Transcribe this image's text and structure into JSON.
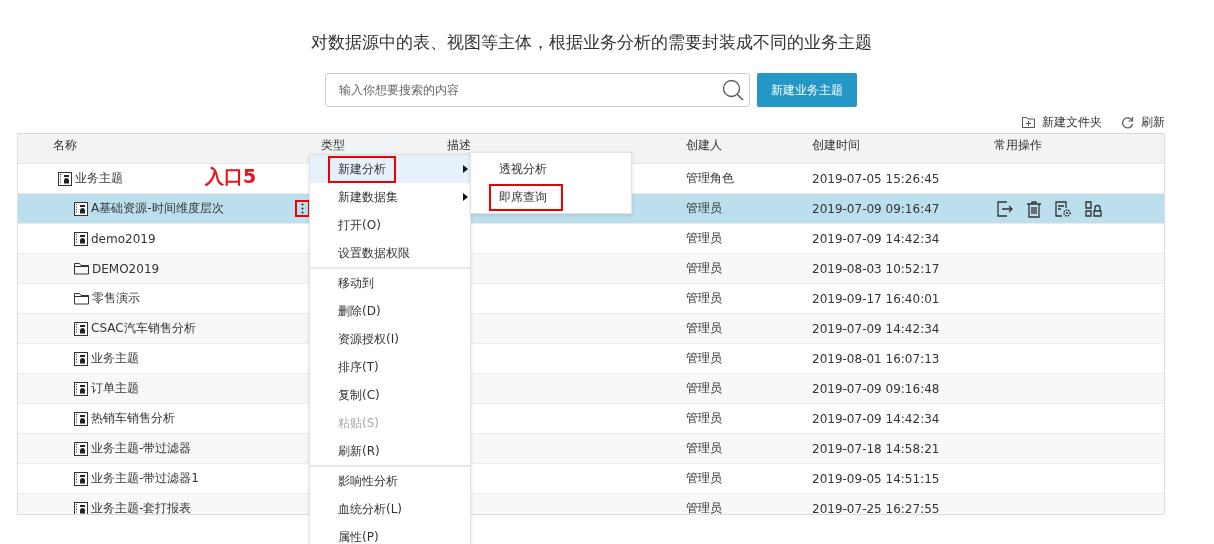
{
  "heading": "对数据源中的表、视图等主体，根据业务分析的需要封装成不同的业务主题",
  "search": {
    "placeholder": "输入你想要搜索的内容"
  },
  "create_button": "新建业务主题",
  "toolbar": [
    {
      "kind": "new-folder",
      "label": "新建文件夹"
    },
    {
      "kind": "refresh",
      "label": "刷新"
    }
  ],
  "table": {
    "columns": [
      "名称",
      "类型",
      "描述",
      "创建人",
      "创建时间",
      "常用操作"
    ],
    "rows": [
      {
        "kind": "topic",
        "name": "业务主题",
        "creator": "管理角色",
        "created": "2019-07-05 15:26:45",
        "selected": false,
        "children": [
          {
            "kind": "topic",
            "name": "A基础资源-时间维度层次",
            "creator": "管理员",
            "created": "2019-07-09 09:16:47",
            "selected": true,
            "more_button_annotated": true
          },
          {
            "kind": "topic",
            "name": "demo2019",
            "creator": "管理员",
            "created": "2019-07-09 14:42:34",
            "selected": false
          },
          {
            "kind": "folder",
            "name": "DEMO2019",
            "creator": "管理员",
            "created": "2019-08-03 10:52:17",
            "selected": false
          },
          {
            "kind": "folder",
            "name": "零售演示",
            "creator": "管理员",
            "created": "2019-09-17 16:40:01",
            "selected": false
          },
          {
            "kind": "topic",
            "name": "CSAC汽车销售分析",
            "creator": "管理员",
            "created": "2019-07-09 14:42:34",
            "selected": false
          },
          {
            "kind": "topic",
            "name": "业务主题",
            "creator": "管理员",
            "created": "2019-08-01 16:07:13",
            "selected": false
          },
          {
            "kind": "topic",
            "name": "订单主题",
            "creator": "管理员",
            "created": "2019-07-09 09:16:48",
            "selected": false
          },
          {
            "kind": "topic",
            "name": "热销车销售分析",
            "creator": "管理员",
            "created": "2019-07-09 14:42:34",
            "selected": false
          },
          {
            "kind": "topic",
            "name": "业务主题-带过滤器",
            "creator": "管理员",
            "created": "2019-07-18 14:58:21",
            "selected": false
          },
          {
            "kind": "topic",
            "name": "业务主题-带过滤器1",
            "creator": "管理员",
            "created": "2019-09-05 14:51:15",
            "selected": false
          },
          {
            "kind": "topic",
            "name": "业务主题-套打报表",
            "creator": "管理员",
            "created": "2019-07-25 16:27:55",
            "selected": false
          }
        ]
      }
    ]
  },
  "annotation": "入口5",
  "context_menu": {
    "groups": [
      [
        {
          "label": "新建分析",
          "submenu": true,
          "selected": true,
          "annotated": true,
          "disabled": false
        },
        {
          "label": "新建数据集",
          "submenu": true,
          "selected": false,
          "annotated": false,
          "disabled": false
        },
        {
          "label": "打开(O)",
          "submenu": false,
          "selected": false,
          "annotated": false,
          "disabled": false
        },
        {
          "label": "设置数据权限",
          "submenu": false,
          "selected": false,
          "annotated": false,
          "disabled": false
        }
      ],
      [
        {
          "label": "移动到",
          "submenu": false,
          "selected": false,
          "annotated": false,
          "disabled": false
        },
        {
          "label": "删除(D)",
          "submenu": false,
          "selected": false,
          "annotated": false,
          "disabled": false
        },
        {
          "label": "资源授权(I)",
          "submenu": false,
          "selected": false,
          "annotated": false,
          "disabled": false
        },
        {
          "label": "排序(T)",
          "submenu": false,
          "selected": false,
          "annotated": false,
          "disabled": false
        },
        {
          "label": "复制(C)",
          "submenu": false,
          "selected": false,
          "annotated": false,
          "disabled": false
        },
        {
          "label": "粘贴(S)",
          "submenu": false,
          "selected": false,
          "annotated": false,
          "disabled": true
        },
        {
          "label": "刷新(R)",
          "submenu": false,
          "selected": false,
          "annotated": false,
          "disabled": false
        }
      ],
      [
        {
          "label": "影响性分析",
          "submenu": false,
          "selected": false,
          "annotated": false,
          "disabled": false
        },
        {
          "label": "血统分析(L)",
          "submenu": false,
          "selected": false,
          "annotated": false,
          "disabled": false
        },
        {
          "label": "属性(P)",
          "submenu": false,
          "selected": false,
          "annotated": false,
          "disabled": false
        }
      ]
    ]
  },
  "submenu": [
    {
      "label": "透视分析",
      "annotated": false
    },
    {
      "label": "即席查询",
      "annotated": true
    }
  ]
}
